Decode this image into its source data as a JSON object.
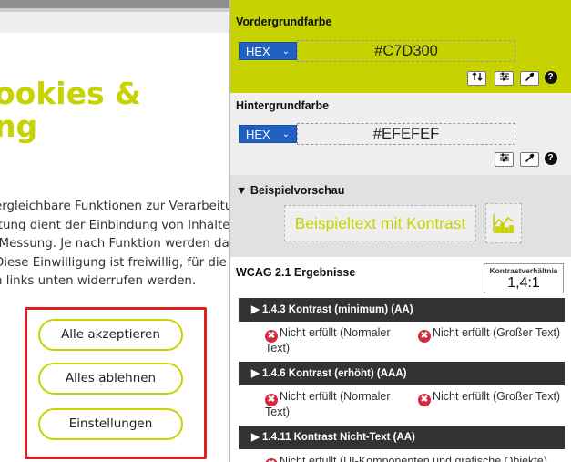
{
  "cookie_page": {
    "title_line1": "ookies &",
    "title_line2": "ng",
    "text_lines": [
      "ergleichbare Funktionen zur Verarbeitun",
      "itung dient der Einbindung von Inhalten",
      "/Messung. Je nach Funktion werden dab",
      "Diese Einwilligung ist freiwillig, für die N",
      "n links unten widerrufen werden."
    ],
    "buttons": {
      "accept_all": "Alle akzeptieren",
      "reject_all": "Alles ablehnen",
      "settings": "Einstellungen"
    }
  },
  "checker": {
    "foreground": {
      "title": "Vordergrundfarbe",
      "format": "HEX",
      "value": "#C7D300",
      "color": "#C7D300"
    },
    "background": {
      "title": "Hintergrundfarbe",
      "format": "HEX",
      "value": "#EFEFEF",
      "color": "#EFEFEF"
    },
    "icons": {
      "swap": "swap-icon",
      "adjust": "sliders-icon",
      "eyedropper": "eyedropper-icon",
      "help": "help-icon"
    },
    "preview": {
      "title": "▼ Beispielvorschau",
      "sample_text": "Beispieltext mit Kontrast"
    },
    "results": {
      "title": "WCAG 2.1 Ergebnisse",
      "ratio_label": "Kontrastverhältnis",
      "ratio_value": "1,4:1",
      "criteria": [
        {
          "label": "▶ 1.4.3 Kontrast (minimum) (AA)",
          "result_normal_1": "Nicht erfüllt (Normaler",
          "result_normal_2": "Text)",
          "result_large": "Nicht erfüllt (Großer Text)"
        },
        {
          "label": "▶ 1.4.6 Kontrast (erhöht) (AAA)",
          "result_normal_1": "Nicht erfüllt (Normaler",
          "result_normal_2": "Text)",
          "result_large": "Nicht erfüllt (Großer Text)"
        },
        {
          "label": "▶ 1.4.11 Kontrast Nicht-Text (AA)",
          "result_partial": "Nicht erfüllt (UI-Komponenten und grafische Objekte)"
        }
      ]
    }
  },
  "colors": {
    "accent": "#C7D300",
    "fail": "#D62A3C",
    "select_blue": "#2060C0",
    "highlight_red": "#E02020"
  }
}
